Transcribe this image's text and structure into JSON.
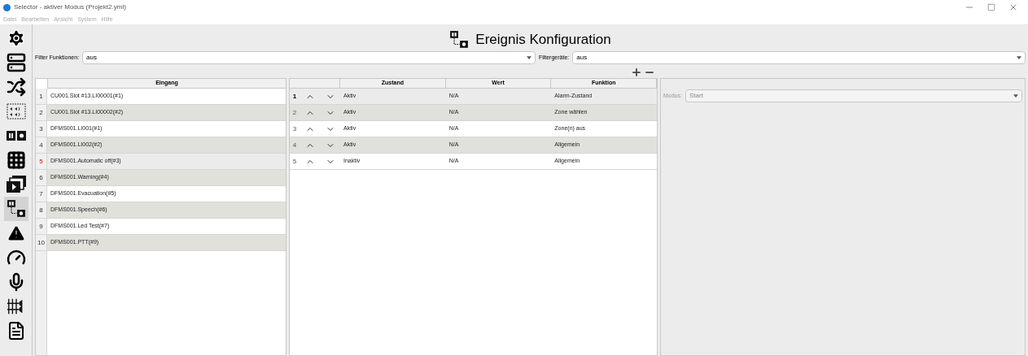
{
  "window": {
    "title": "Selector - aktiver Modus (Projekt2.yml)"
  },
  "menu": [
    "Datei",
    "Bearbeiten",
    "Ansicht",
    "System",
    "Hilfe"
  ],
  "sidebar": {
    "items": [
      {
        "kind": "gear",
        "selected": false
      },
      {
        "kind": "server",
        "selected": false
      },
      {
        "kind": "shuffle",
        "selected": false
      },
      {
        "kind": "speakers",
        "selected": false
      },
      {
        "kind": "boxes",
        "selected": false
      },
      {
        "kind": "grid",
        "selected": false
      },
      {
        "kind": "media",
        "selected": false
      },
      {
        "kind": "event",
        "selected": true
      },
      {
        "kind": "warning",
        "selected": false
      },
      {
        "kind": "gauge",
        "selected": false
      },
      {
        "kind": "mic",
        "selected": false
      },
      {
        "kind": "mixer",
        "selected": false
      },
      {
        "kind": "document",
        "selected": false
      }
    ]
  },
  "heading": "Ereignis Konfiguration",
  "filter_funktionen": {
    "label": "Filter Funktionen:",
    "value": "aus"
  },
  "filtergeraete": {
    "label": "Filtergeräte:",
    "value": "aus"
  },
  "eingang_table": {
    "column": "Eingang",
    "rows": [
      {
        "number": "1",
        "name": "CU001.Slot #13.LI00001(#1)",
        "selected": false
      },
      {
        "number": "2",
        "name": "CU001.Slot #13.LI00002(#2)",
        "selected": false
      },
      {
        "number": "3",
        "name": "DFMS001.LI001(#1)",
        "selected": false
      },
      {
        "number": "4",
        "name": "DFMS001.LI002(#2)",
        "selected": false
      },
      {
        "number": "5",
        "name": "DFMS001.Automatic off(#3)",
        "selected": true
      },
      {
        "number": "6",
        "name": "DFMS001.Warning(#4)",
        "selected": false
      },
      {
        "number": "7",
        "name": "DFMS001.Evacuation(#5)",
        "selected": false
      },
      {
        "number": "8",
        "name": "DFMS001.Speech(#6)",
        "selected": false
      },
      {
        "number": "9",
        "name": "DFMS001.Led Test(#7)",
        "selected": false
      },
      {
        "number": "10",
        "name": "DFMS001.PTT(#9)",
        "selected": false
      }
    ]
  },
  "event_table": {
    "columns": [
      "Zustand",
      "Wert",
      "Funktion"
    ],
    "rows": [
      {
        "number": "1",
        "zustand": "Aktiv",
        "wert": "N/A",
        "funktion": "Alarm-Zustand",
        "selected": true
      },
      {
        "number": "2",
        "zustand": "Aktiv",
        "wert": "N/A",
        "funktion": "Zone wählen",
        "selected": false
      },
      {
        "number": "3",
        "zustand": "Aktiv",
        "wert": "N/A",
        "funktion": "Zone(n) aus",
        "selected": false
      },
      {
        "number": "4",
        "zustand": "Aktiv",
        "wert": "N/A",
        "funktion": "Allgemein",
        "selected": false
      },
      {
        "number": "5",
        "zustand": "Inaktiv",
        "wert": "N/A",
        "funktion": "Allgemein",
        "selected": false
      }
    ]
  },
  "modus": {
    "label": "Modus:",
    "value": "Start",
    "disabled": true
  }
}
